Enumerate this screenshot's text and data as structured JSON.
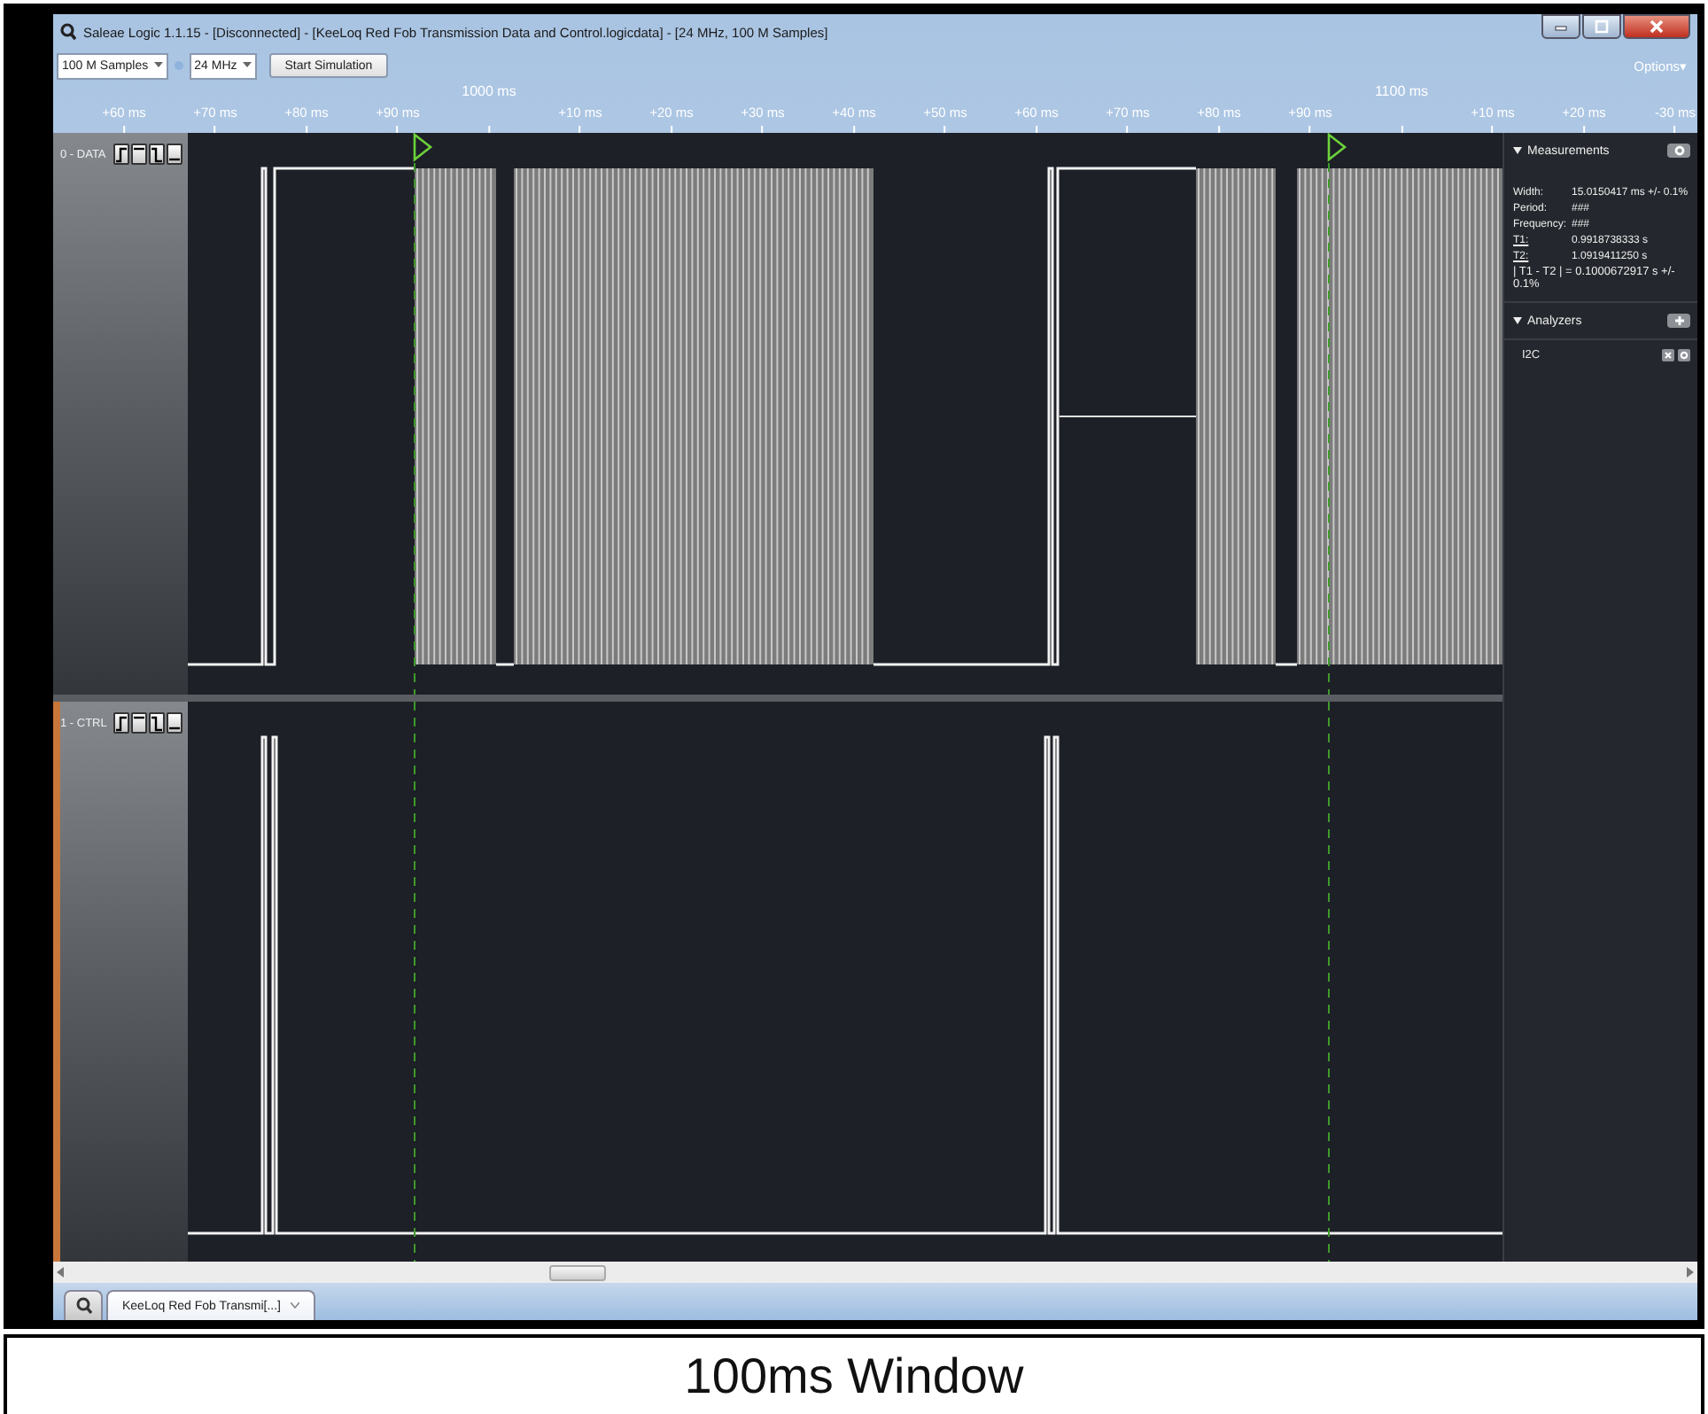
{
  "window": {
    "title": "Saleae Logic 1.1.15 - [Disconnected] - [KeeLoq Red Fob Transmission Data and Control.logicdata] - [24 MHz, 100 M Samples]"
  },
  "toolbar": {
    "sample_count": "100 M Samples",
    "sample_rate": "24 MHz",
    "start_button": "Start Simulation",
    "options": "Options▾"
  },
  "ruler": {
    "ticks": [
      {
        "label": "+60 ms",
        "major": false
      },
      {
        "label": "+70 ms",
        "major": false
      },
      {
        "label": "+80 ms",
        "major": false
      },
      {
        "label": "+90 ms",
        "major": false
      },
      {
        "label": "1000 ms",
        "major": true
      },
      {
        "label": "+10 ms",
        "major": false
      },
      {
        "label": "+20 ms",
        "major": false
      },
      {
        "label": "+30 ms",
        "major": false
      },
      {
        "label": "+40 ms",
        "major": false
      },
      {
        "label": "+50 ms",
        "major": false
      },
      {
        "label": "+60 ms",
        "major": false
      },
      {
        "label": "+70 ms",
        "major": false
      },
      {
        "label": "+80 ms",
        "major": false
      },
      {
        "label": "+90 ms",
        "major": false
      },
      {
        "label": "1100 ms",
        "major": true
      },
      {
        "label": "+10 ms",
        "major": false
      },
      {
        "label": "+20 ms",
        "major": false
      },
      {
        "label": "-30 ms",
        "major": false
      }
    ]
  },
  "channels": [
    {
      "name": "0 - DATA",
      "kind": "data",
      "selected": false
    },
    {
      "name": "1 - CTRL",
      "kind": "ctrl",
      "selected": true
    }
  ],
  "measurements": {
    "title": "Measurements",
    "rows": [
      {
        "label": "Width:",
        "value": "15.0150417 ms +/- 0.1%",
        "kind": "plain"
      },
      {
        "label": "Period:",
        "value": "###",
        "kind": "plain"
      },
      {
        "label": "Frequency:",
        "value": "###",
        "kind": "plain"
      },
      {
        "label": "T1:",
        "value": "0.9918738333 s",
        "kind": "link"
      },
      {
        "label": "T2:",
        "value": "1.0919411250 s",
        "kind": "link"
      }
    ],
    "difference": "| T1 - T2 | = 0.1000672917 s +/- 0.1%"
  },
  "analyzers": {
    "title": "Analyzers",
    "items": [
      "I2C"
    ]
  },
  "tabs": [
    {
      "label": "KeeLoq Red Fob Transmi[...]",
      "selected": true
    }
  ],
  "caption": "100ms Window"
}
